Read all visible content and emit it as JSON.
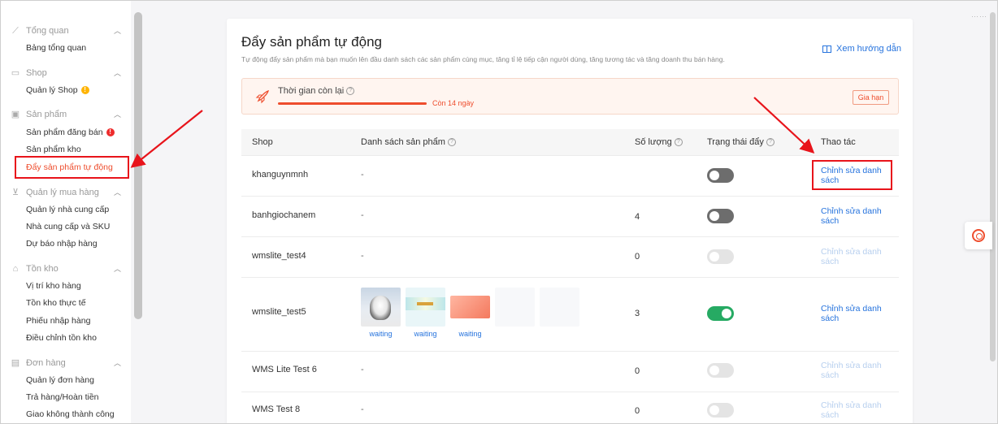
{
  "sidebar": {
    "groups": [
      {
        "title": "Tổng quan",
        "icon": "chart-line-icon",
        "items": [
          {
            "label": "Bảng tổng quan"
          }
        ]
      },
      {
        "title": "Shop",
        "icon": "shop-icon",
        "items": [
          {
            "label": "Quản lý Shop",
            "badge": "!"
          }
        ]
      },
      {
        "title": "Sản phẩm",
        "icon": "box-icon",
        "items": [
          {
            "label": "Sản phẩm đăng bán",
            "badge": "!"
          },
          {
            "label": "Sản phẩm kho"
          },
          {
            "label": "Đẩy sản phẩm tự động"
          }
        ]
      },
      {
        "title": "Quản lý mua hàng",
        "icon": "cart-icon",
        "items": [
          {
            "label": "Quản lý nhà cung cấp"
          },
          {
            "label": "Nhà cung cấp và SKU"
          },
          {
            "label": "Dự báo nhập hàng"
          }
        ]
      },
      {
        "title": "Tồn kho",
        "icon": "warehouse-icon",
        "items": [
          {
            "label": "Vị trí kho hàng"
          },
          {
            "label": "Tồn kho thực tế"
          },
          {
            "label": "Phiếu nhập hàng"
          },
          {
            "label": "Điều chỉnh tồn kho"
          }
        ]
      },
      {
        "title": "Đơn hàng",
        "icon": "clipboard-icon",
        "items": [
          {
            "label": "Quản lý đơn hàng"
          },
          {
            "label": "Trả hàng/Hoàn tiền"
          },
          {
            "label": "Giao không thành công"
          }
        ]
      }
    ]
  },
  "page": {
    "title": "Đẩy sản phẩm tự động",
    "description": "Tự động đẩy sản phẩm mà bạn muốn lên đầu danh sách các sản phẩm cùng mục, tăng tỉ lệ tiếp cận người dùng, tăng tương tác và tăng doanh thu bán hàng.",
    "guide_link": "Xem hướng dẫn"
  },
  "banner": {
    "label": "Thời gian còn lại",
    "remaining": "Còn 14 ngày",
    "renew_button": "Gia hạn"
  },
  "table": {
    "headers": {
      "shop": "Shop",
      "products": "Danh sách sản phẩm",
      "quantity": "Số lượng",
      "status": "Trạng thái đẩy",
      "actions": "Thao tác"
    },
    "rows": [
      {
        "shop": "khanguynmnh",
        "products": "-",
        "quantity": "",
        "status": "off",
        "action": "Chỉnh sửa danh sách",
        "action_enabled": true
      },
      {
        "shop": "banhgiochanem",
        "products": "-",
        "quantity": "4",
        "status": "off",
        "action": "Chỉnh sửa danh sách",
        "action_enabled": true
      },
      {
        "shop": "wmslite_test4",
        "products": "-",
        "quantity": "0",
        "status": "disabled",
        "action": "Chỉnh sửa danh sách",
        "action_enabled": false
      },
      {
        "shop": "wmslite_test5",
        "products": "",
        "quantity": "3",
        "status": "on",
        "action": "Chỉnh sửa danh sách",
        "action_enabled": true,
        "thumbnails": [
          {
            "status": "waiting"
          },
          {
            "status": "waiting"
          },
          {
            "status": "waiting"
          }
        ]
      },
      {
        "shop": "WMS Lite Test 6",
        "products": "-",
        "quantity": "0",
        "status": "disabled",
        "action": "Chỉnh sửa danh sách",
        "action_enabled": false
      },
      {
        "shop": "WMS Test 8",
        "products": "-",
        "quantity": "0",
        "status": "disabled",
        "action": "Chỉnh sửa danh sách",
        "action_enabled": false
      }
    ]
  },
  "colors": {
    "accent": "#ee4d2d",
    "link": "#2673dd",
    "highlight": "#e8141b",
    "toggle_on": "#26aa63"
  }
}
